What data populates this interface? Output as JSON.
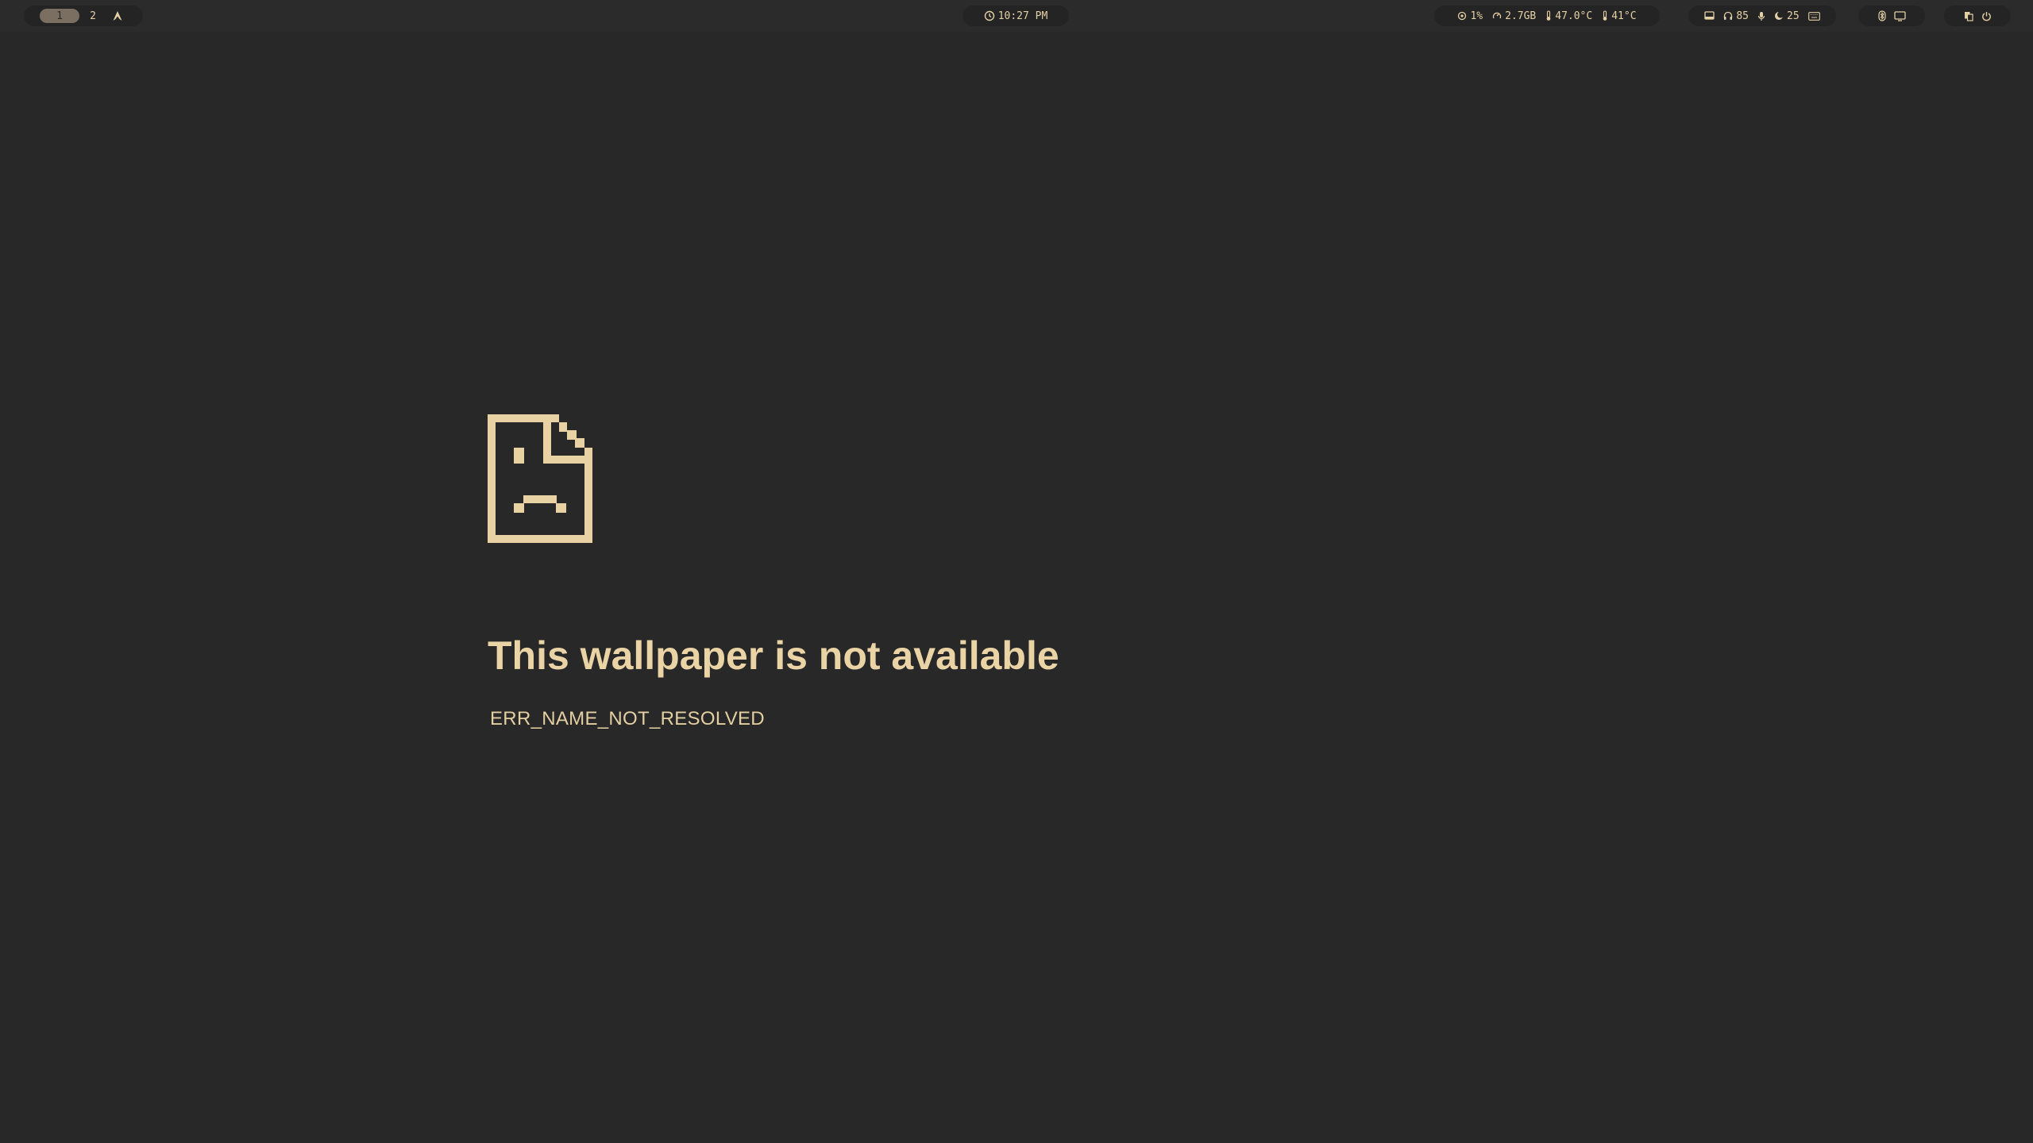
{
  "colors": {
    "background": "#282828",
    "bar_background": "#2b2b2b",
    "pill_background": "#242424",
    "accent": "#e4d0a5",
    "active_workspace": "#7b6f61"
  },
  "topbar": {
    "workspaces": [
      {
        "label": "1",
        "active": true
      },
      {
        "label": "2",
        "active": false
      }
    ],
    "launcher_icon": "arch-logo-icon",
    "clock": {
      "icon": "clock-icon",
      "time": "10:27 PM"
    },
    "system": {
      "cpu": {
        "icon": "cpu-icon",
        "value": "1%"
      },
      "memory": {
        "icon": "memory-icon",
        "value": "2.7GB"
      },
      "cpu_temp": {
        "icon": "thermometer-icon",
        "value": "47.0°C"
      },
      "gpu_temp": {
        "icon": "thermometer-icon",
        "value": "41°C"
      }
    },
    "audio": {
      "screen_icon": "screen-icon",
      "headphones": {
        "icon": "headphones-icon",
        "value": "85"
      },
      "microphone": {
        "icon": "microphone-icon"
      },
      "brightness": {
        "icon": "brightness-icon",
        "value": "25"
      },
      "keyboard_icon": "keyboard-icon"
    },
    "connectivity": {
      "bluetooth_icon": "bluetooth-icon",
      "display_icon": "display-icon"
    },
    "power": {
      "clipboard_icon": "clipboard-icon",
      "power_icon": "power-icon"
    }
  },
  "main": {
    "icon": "sad-file-icon",
    "title": "This wallpaper is not available",
    "error_code": "ERR_NAME_NOT_RESOLVED"
  }
}
